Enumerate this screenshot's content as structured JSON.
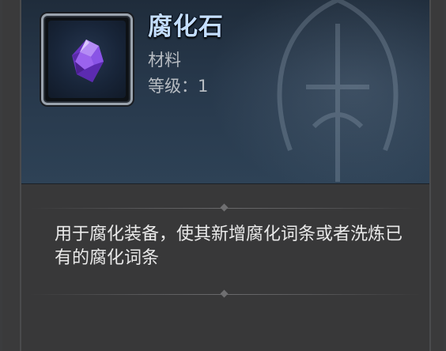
{
  "item": {
    "name": "腐化石",
    "type": "材料",
    "level_text": "等级：1",
    "icon": "purple-crystal-icon",
    "description": "用于腐化装备，使其新增腐化词条或者洗炼已有的腐化词条"
  },
  "colors": {
    "name_color": "#c4deff",
    "header_bg": "#27384b",
    "body_bg": "#383839",
    "gem_purple": "#8a4fe0"
  }
}
